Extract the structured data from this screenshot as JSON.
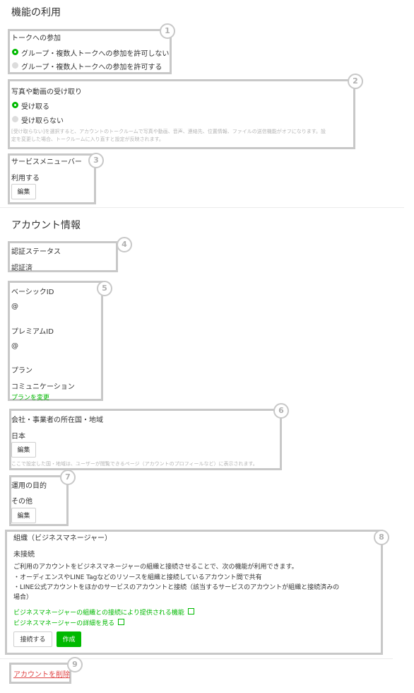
{
  "sections": {
    "features_title": "機能の利用",
    "account_title": "アカウント情報"
  },
  "talk": {
    "heading": "トークへの参加",
    "options": [
      "グループ・複数人トークへの参加を許可しない",
      "グループ・複数人トークへの参加を許可する"
    ],
    "selected": 0
  },
  "media": {
    "heading": "写真や動画の受け取り",
    "options": [
      "受け取る",
      "受け取らない"
    ],
    "selected": 0,
    "note_line1": "[受け取らない]を選択すると、アカウントのトークルームで写真や動画、音声、連絡先、位置情報、ファイルの送信機能がオフになります。設",
    "note_line2": "定を変更した場合、トークルームに入り直すと設定が反映されます。"
  },
  "service_menu": {
    "heading": "サービスメニューバー",
    "value": "利用する",
    "edit_label": "編集"
  },
  "auth": {
    "heading": "認証ステータス",
    "value": "認証済"
  },
  "ids": {
    "basic_label": "ベーシックID",
    "basic_value": "@",
    "premium_label": "プレミアムID",
    "premium_value": "@",
    "plan_label": "プラン",
    "plan_value": "コミュニケーション",
    "change_plan": "プランを変更"
  },
  "country": {
    "heading": "会社・事業者の所在国・地域",
    "value": "日本",
    "edit_label": "編集",
    "note": "ここで設定した国・地域は、ユーザーが閲覧できるページ（アカウントのプロフィールなど）に表示されます。"
  },
  "purpose": {
    "heading": "運用の目的",
    "value": "その他",
    "edit_label": "編集"
  },
  "org": {
    "heading": "組織（ビジネスマネージャー）",
    "status": "未接続",
    "desc": "ご利用のアカウントをビジネスマネージャーの組織と接続させることで、次の機能が利用できます。",
    "bullet1": "・オーディエンスやLINE Tagなどのリソースを組織と接続しているアカウント間で共有",
    "bullet2a": "・LINE公式アカウントをほかのサービスのアカウントと接続（該当するサービスのアカウントが組織と接続済みの",
    "bullet2b": "場合）",
    "link1": "ビジネスマネージャーの組織との接続により提供される機能",
    "link2": "ビジネスマネージャーの詳細を見る",
    "connect_label": "接続する",
    "create_label": "作成"
  },
  "delete": {
    "label": "アカウントを削除"
  },
  "badges": [
    "1",
    "2",
    "3",
    "4",
    "5",
    "6",
    "7",
    "8",
    "9"
  ],
  "icons": {
    "radio_selected": "radio-selected-icon",
    "radio_unselected": "radio-unselected-icon",
    "external": "external-link-icon"
  },
  "colors": {
    "accent": "#00b900",
    "danger": "#e04646",
    "annotation": "#c8c8c8"
  }
}
